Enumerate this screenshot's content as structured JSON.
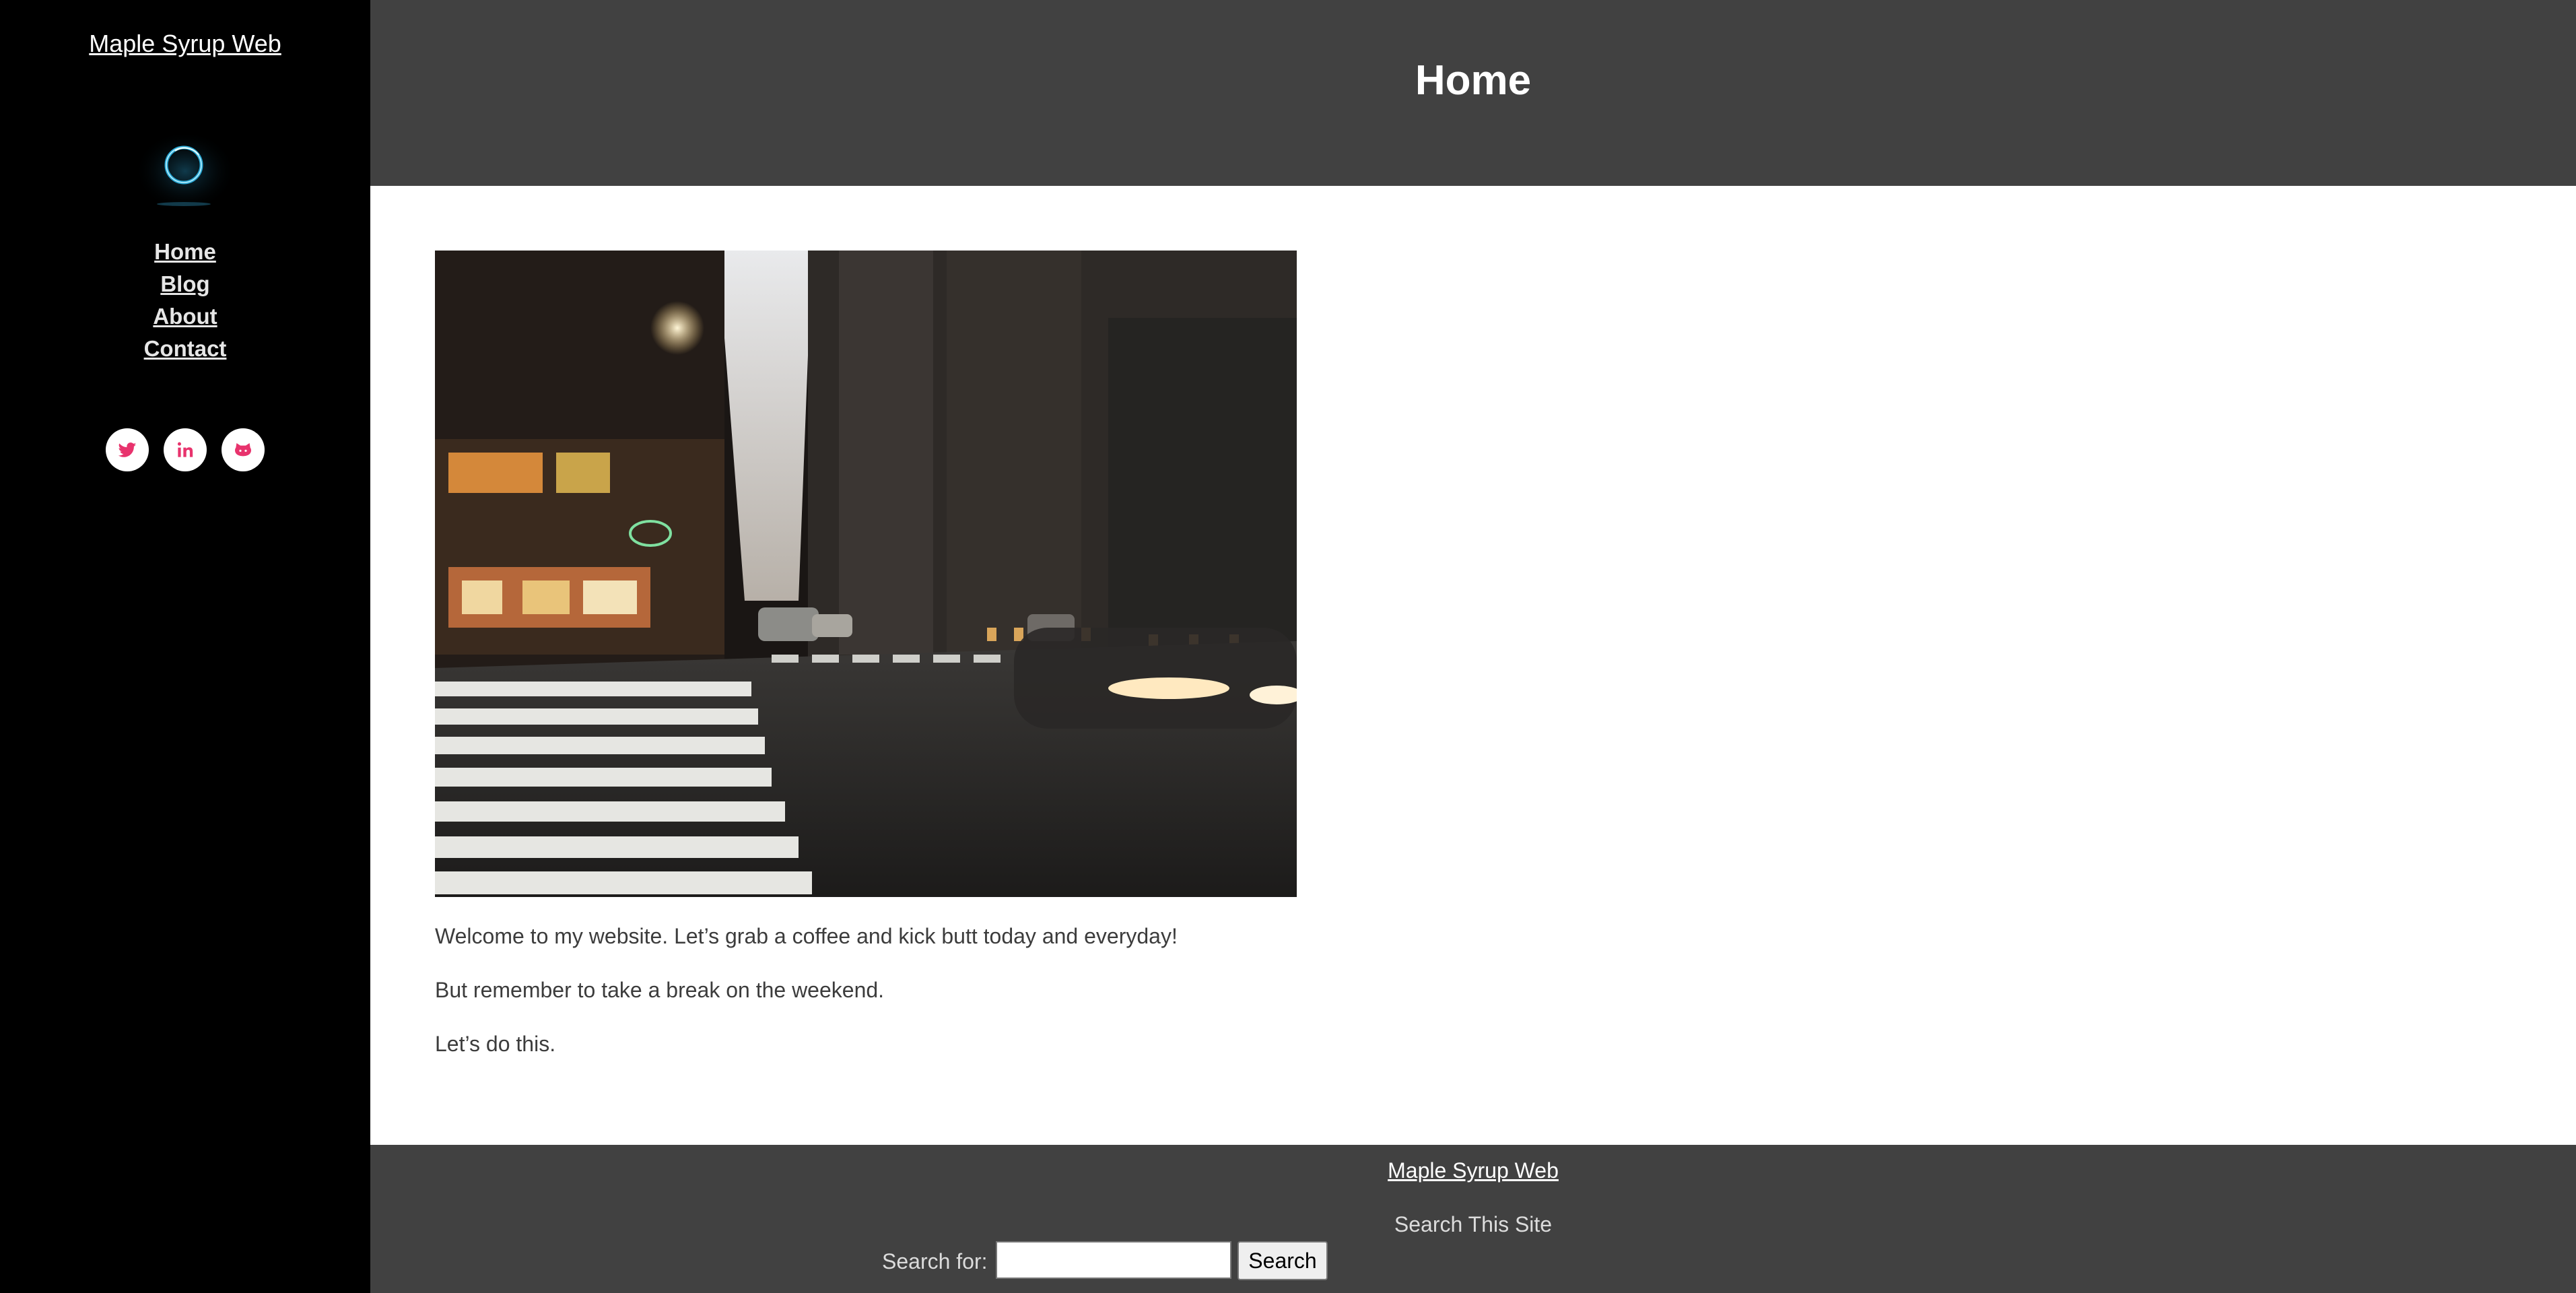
{
  "sidebar": {
    "site_title": "Maple Syrup Web",
    "logo_icon": "glowing-ring-logo",
    "nav": [
      {
        "label": "Home"
      },
      {
        "label": "Blog"
      },
      {
        "label": "About"
      },
      {
        "label": "Contact"
      }
    ],
    "social": [
      {
        "icon": "twitter-icon"
      },
      {
        "icon": "linkedin-icon",
        "glyph": "in"
      },
      {
        "icon": "github-icon"
      }
    ],
    "social_icon_color": "#e8336d"
  },
  "header": {
    "title": "Home"
  },
  "main": {
    "hero_image": "night-city-street-photo",
    "paragraphs": [
      "Welcome to my website. Let’s grab a coffee and kick butt today and everyday!",
      "But remember to take a break on the weekend.",
      "Let’s do this."
    ]
  },
  "footer": {
    "site_link": "Maple Syrup Web",
    "search_heading": "Search This Site",
    "search_label": "Search for:",
    "search_value": "",
    "search_button": "Search"
  },
  "colors": {
    "sidebar_bg": "#000000",
    "header_bg": "#414141",
    "footer_bg": "#414141",
    "accent": "#e8336d"
  }
}
